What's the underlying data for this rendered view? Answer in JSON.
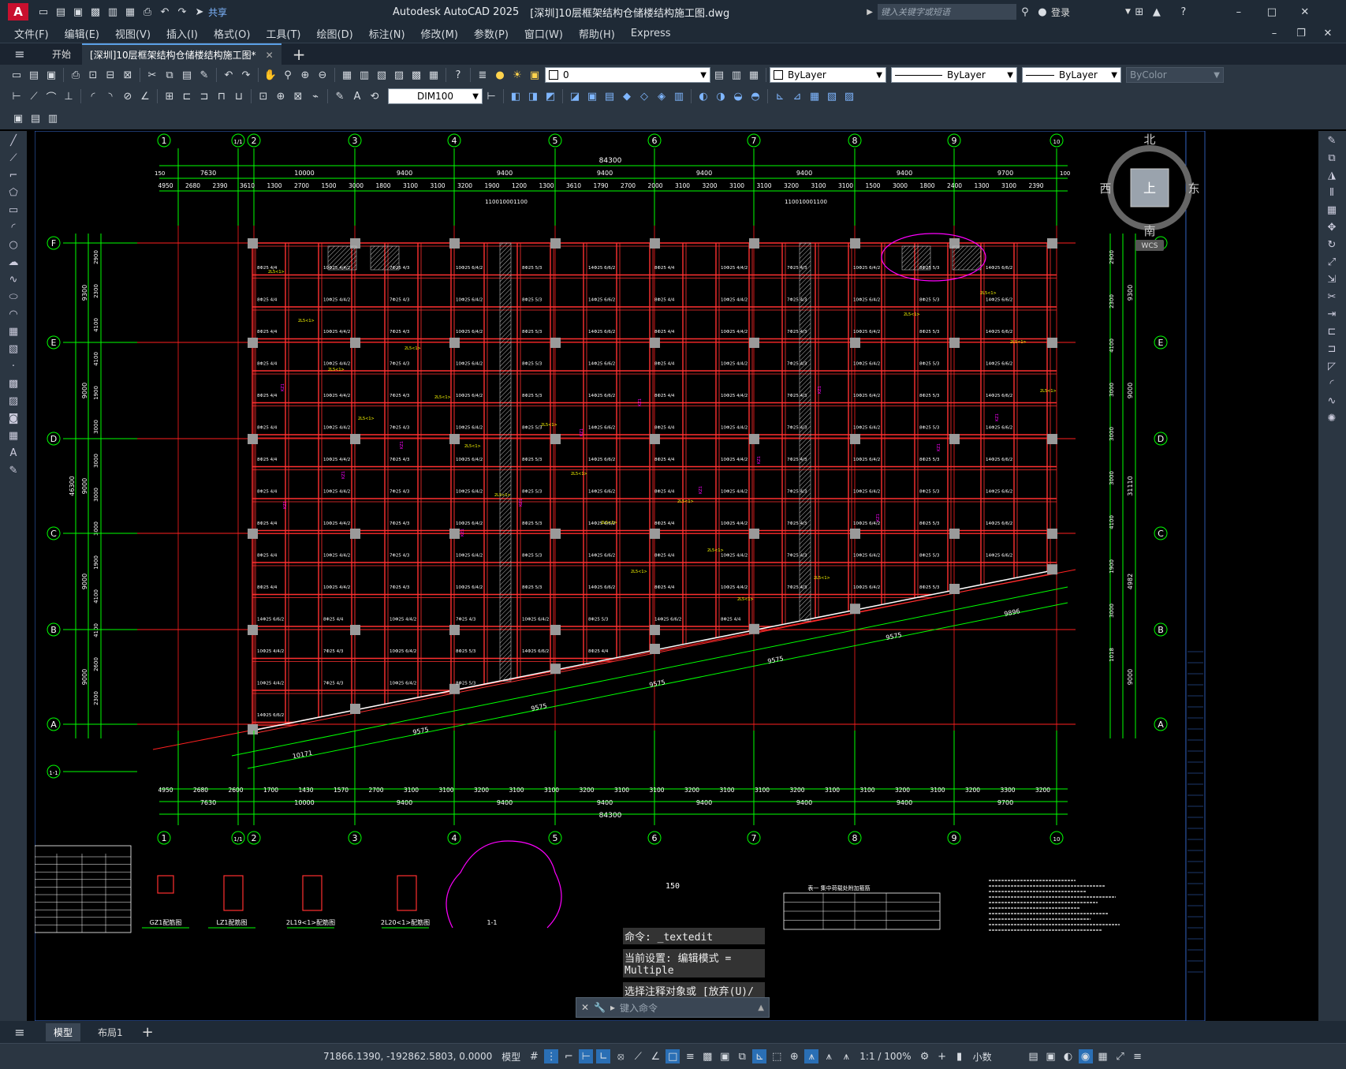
{
  "app": {
    "title": "Autodesk AutoCAD 2025",
    "document_title": "[深圳]10层框架结构仓储楼结构施工图.dwg",
    "search_placeholder": "键入关键字或短语",
    "login_label": "登录",
    "share_label": "共享",
    "logo_letter": "A"
  },
  "menu": [
    "文件(F)",
    "编辑(E)",
    "视图(V)",
    "插入(I)",
    "格式(O)",
    "工具(T)",
    "绘图(D)",
    "标注(N)",
    "修改(M)",
    "参数(P)",
    "窗口(W)",
    "帮助(H)",
    "Express"
  ],
  "tabs": {
    "start_label": "开始",
    "doc_tab_label": "[深圳]10层框架结构仓储楼结构施工图*",
    "add_label": "+"
  },
  "toolbar": {
    "layer_value": "0",
    "color_value": "ByLayer",
    "linetype_value": "ByLayer",
    "lineweight_value": "ByLayer",
    "plotstyle_value": "ByColor",
    "dimstyle_value": "DIM100"
  },
  "viewcube": {
    "north": "北",
    "south": "南",
    "east": "东",
    "west": "西",
    "face": "上",
    "wcs": "WCS"
  },
  "drawing": {
    "grid_numbers": [
      "1",
      "1/1",
      "2",
      "3",
      "4",
      "5",
      "6",
      "7",
      "8",
      "9",
      "10"
    ],
    "grid_letters": [
      "F",
      "E",
      "D",
      "C",
      "B",
      "A",
      "1-1"
    ],
    "top_total": "84300",
    "top_spans": [
      "7630",
      "10000",
      "9400",
      "9400",
      "9400",
      "9400",
      "9400",
      "9400",
      "9700"
    ],
    "top_detail": [
      "4950",
      "2680",
      "2390",
      "3610",
      "1300",
      "2700",
      "1500",
      "3000",
      "1800",
      "3100",
      "3100",
      "3200",
      "1900",
      "1200",
      "1300",
      "3610",
      "1790",
      "2700",
      "2000",
      "3100",
      "3200",
      "3100",
      "3100",
      "3200",
      "3100",
      "3100",
      "1500",
      "3000",
      "1800",
      "2400",
      "1300",
      "3100",
      "2390"
    ],
    "top_small": [
      "1100",
      "1000",
      "1100",
      "1100",
      "1000",
      "1100"
    ],
    "bottom_total": "84300",
    "bottom_spans": [
      "7630",
      "10000",
      "9400",
      "9400",
      "9400",
      "9400",
      "9400",
      "9400",
      "9700"
    ],
    "bottom_detail": [
      "4950",
      "2680",
      "2600",
      "1700",
      "1430",
      "1570",
      "2700",
      "3100",
      "3100",
      "3200",
      "3100",
      "3100",
      "3200",
      "3100",
      "3100",
      "3200",
      "3100",
      "3100",
      "3200",
      "3100",
      "3100",
      "3200",
      "3100",
      "3200",
      "3300",
      "3200"
    ],
    "left_total": "46300",
    "left_spans": [
      "9300",
      "9000",
      "9000",
      "9000",
      "9000"
    ],
    "left_detail": [
      "2900",
      "2300",
      "4100",
      "4100",
      "1900",
      "3000",
      "3000",
      "3000",
      "3000",
      "1900",
      "4100",
      "4100",
      "2600",
      "2300"
    ],
    "right_spans": [
      "9300",
      "9000",
      "31110",
      "4982",
      "9000"
    ],
    "right_detail": [
      "2900",
      "2300",
      "4100",
      "3000",
      "3000",
      "3000",
      "4100",
      "1900",
      "3000",
      "1018"
    ],
    "slant_dims": [
      "9896",
      "9575",
      "9575",
      "9575",
      "9575",
      "9575",
      "10171"
    ],
    "edge_marks": [
      "150",
      "100"
    ],
    "legend_labels": [
      "GZ1配筋图",
      "LZ1配筋图",
      "2L19<1>配筋图",
      "2L20<1>配筋图",
      "1-1"
    ],
    "table_title": "表一  集中荷载处附加箍筋"
  },
  "command": {
    "history": [
      "命令: _textedit",
      "当前设置: 编辑模式 = Multiple",
      "选择注释对象或 [放弃(U)/模式(M)]: *取消*"
    ],
    "input_placeholder": "键入命令",
    "scale_note": "150"
  },
  "layout_tabs": [
    "模型",
    "布局1"
  ],
  "status": {
    "coords": "71866.1390, -192862.5803, 0.0000",
    "model_label": "模型",
    "scale": "1:1 / 100%",
    "units": "小数"
  },
  "colors": {
    "grid_line": "#ff2020",
    "beam": "#ff3030",
    "dimension": "#00ff00",
    "text": "#ffffff",
    "annotation": "#ffff00",
    "revision_cloud": "#ff00ff",
    "column": "#9a9a9a"
  }
}
